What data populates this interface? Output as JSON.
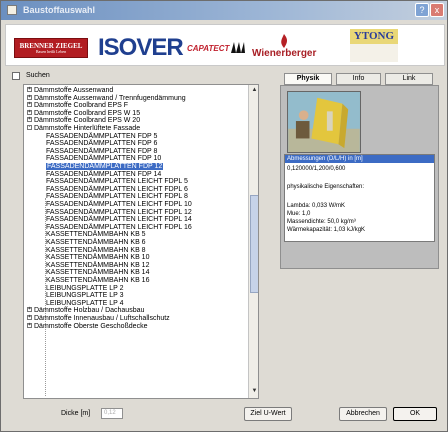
{
  "window": {
    "title": "Baustoffauswahl",
    "close_glyph": "x"
  },
  "logos": {
    "brenner_main": "BRENNER ZIEGEL",
    "brenner_sub": "Bauen heißt Leben",
    "isover": "ISOVER",
    "capatect": "CAPATECT",
    "wienerberger": "Wienerberger",
    "ytong": "YTONG"
  },
  "search": {
    "label": "Suchen",
    "checked": false
  },
  "tree": {
    "items": [
      {
        "label": "Dämmstoffe Aussenwand",
        "level": 0,
        "expander": "+"
      },
      {
        "label": "Dämmstoffe Aussenwand / Trennfugendämmung",
        "level": 0,
        "expander": "+"
      },
      {
        "label": "Dämmstoffe Coolbrand EPS F",
        "level": 0,
        "expander": "+"
      },
      {
        "label": "Dämmstoffe Coolbrand EPS W 15",
        "level": 0,
        "expander": "+"
      },
      {
        "label": "Dämmstoffe Coolbrand EPS W 20",
        "level": 0,
        "expander": "+"
      },
      {
        "label": "Dämmstoffe Hinterlüftete Fassade",
        "level": 0,
        "expander": "-"
      },
      {
        "label": "FASSADENDÄMMPLATTEN FDP 5",
        "level": 1
      },
      {
        "label": "FASSADENDÄMMPLATTEN FDP 6",
        "level": 1
      },
      {
        "label": "FASSADENDÄMMPLATTEN FDP 8",
        "level": 1
      },
      {
        "label": "FASSADENDÄMMPLATTEN FDP 10",
        "level": 1
      },
      {
        "label": "FASSADENDÄMMPLATTEN FDP 12",
        "level": 1,
        "selected": true
      },
      {
        "label": "FASSADENDÄMMPLATTEN FDP 14",
        "level": 1
      },
      {
        "label": "FASSADENDÄMMPLATTEN LEICHT FDPL 5",
        "level": 1
      },
      {
        "label": "FASSADENDÄMMPLATTEN LEICHT FDPL 6",
        "level": 1
      },
      {
        "label": "FASSADENDÄMMPLATTEN LEICHT FDPL 8",
        "level": 1
      },
      {
        "label": "FASSADENDÄMMPLATTEN LEICHT FDPL 10",
        "level": 1
      },
      {
        "label": "FASSADENDÄMMPLATTEN LEICHT FDPL 12",
        "level": 1
      },
      {
        "label": "FASSADENDÄMMPLATTEN LEICHT FDPL 14",
        "level": 1
      },
      {
        "label": "FASSADENDÄMMPLATTEN LEICHT FDPL 16",
        "level": 1
      },
      {
        "label": "KASSETTENDÄMMBAHN KB 5",
        "level": 1
      },
      {
        "label": "KASSETTENDÄMMBAHN KB 6",
        "level": 1
      },
      {
        "label": "KASSETTENDÄMMBAHN KB 8",
        "level": 1
      },
      {
        "label": "KASSETTENDÄMMBAHN KB 10",
        "level": 1
      },
      {
        "label": "KASSETTENDÄMMBAHN KB 12",
        "level": 1
      },
      {
        "label": "KASSETTENDÄMMBAHN KB 14",
        "level": 1
      },
      {
        "label": "KASSETTENDÄMMBAHN KB 16",
        "level": 1
      },
      {
        "label": "LEIBUNGSPLATTE LP 2",
        "level": 1
      },
      {
        "label": "LEIBUNGSPLATTE LP 3",
        "level": 1
      },
      {
        "label": "LEIBUNGSPLATTE LP 4",
        "level": 1
      },
      {
        "label": "Dämmstoffe Holzbau / Dachausbau",
        "level": 0,
        "expander": "+"
      },
      {
        "label": "Dämmstoffe Innenausbau / Luftschallschutz",
        "level": 0,
        "expander": "+"
      },
      {
        "label": "Dämmstoffe Oberste Geschoßdecke",
        "level": 0,
        "expander": "+"
      }
    ]
  },
  "tabs": [
    {
      "label": "Physik",
      "active": true
    },
    {
      "label": "Info",
      "active": false
    },
    {
      "label": "Link",
      "active": false
    }
  ],
  "physik": {
    "dim_header": "Abmessungen (D/L/H) in [m]",
    "dim_value": "0,120000/1,200/0,600",
    "props_header": "physikalische Eigenschaften:",
    "lambda": "Lambda: 0,033 W/mK",
    "mue": "Mue: 1,0",
    "dichte": "Massendichte: 50,0 kg/m³",
    "waerme": "Wärmekapazität: 1,03 kJ/kgK"
  },
  "bottom": {
    "dicke_label": "Dicke [m]",
    "dicke_value": "0,12",
    "ziel_button": "Ziel U-Wert",
    "cancel_button": "Abbrechen",
    "ok_button": "OK"
  }
}
